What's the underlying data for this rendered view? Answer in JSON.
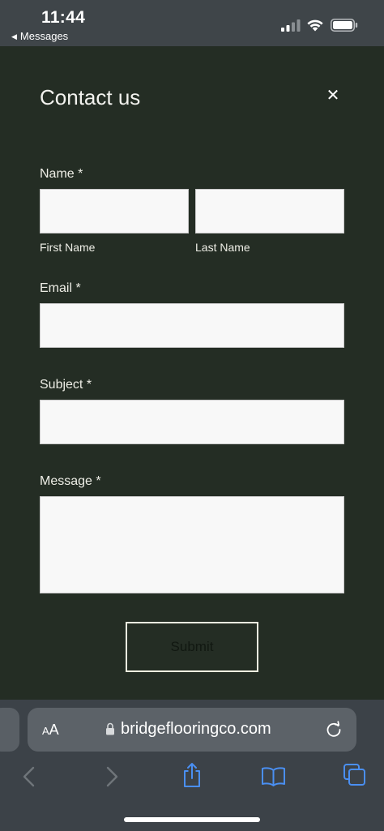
{
  "status_bar": {
    "time": "11:44",
    "back_app": "Messages"
  },
  "modal": {
    "title": "Contact us",
    "close_glyph": "✕",
    "fields": {
      "name_label": "Name *",
      "first_name_sublabel": "First Name",
      "last_name_sublabel": "Last Name",
      "first_name_value": "",
      "last_name_value": "",
      "email_label": "Email *",
      "email_value": "",
      "subject_label": "Subject *",
      "subject_value": "",
      "message_label": "Message *",
      "message_value": ""
    },
    "submit_label": "Submit"
  },
  "browser": {
    "aa_label_small": "A",
    "aa_label_large": "A",
    "url": "bridgeflooringco.com"
  },
  "colors": {
    "modal_background": "#242d24",
    "status_bar_background": "#3f4549",
    "toolbar_background": "#3c4248",
    "input_background": "#f8f8f8",
    "text_light": "#eeeee6",
    "accent_blue": "#3b82f6"
  },
  "icons": {
    "back": "triangle-left-icon",
    "signal": "cellular-signal-icon",
    "wifi": "wifi-icon",
    "battery": "battery-icon",
    "close": "close-icon",
    "lock": "lock-icon",
    "reload": "reload-icon",
    "nav_back": "chevron-left-icon",
    "nav_forward": "chevron-right-icon",
    "share": "share-icon",
    "bookmarks": "book-icon",
    "tabs": "tabs-icon"
  }
}
